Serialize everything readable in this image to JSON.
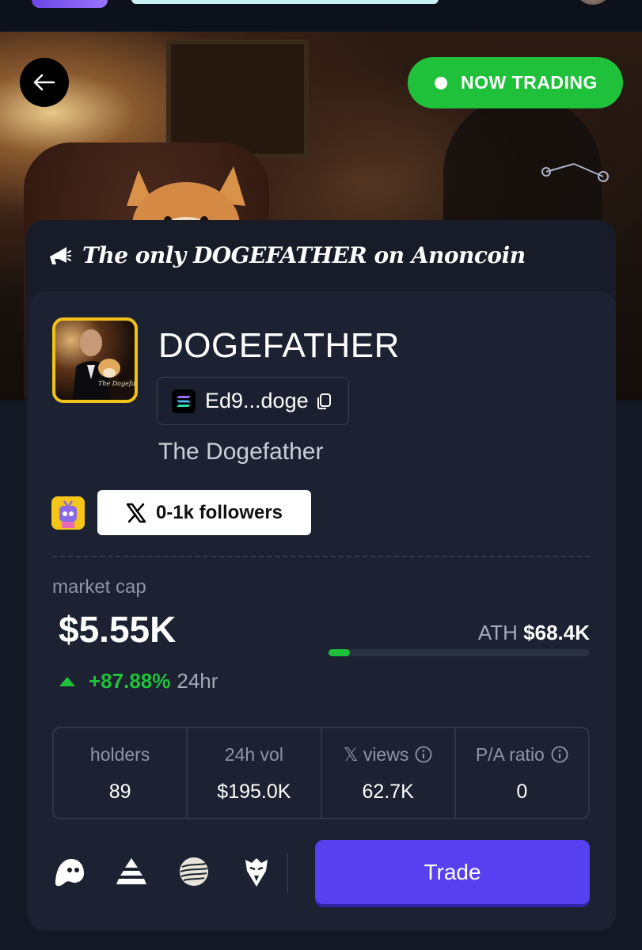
{
  "header": {
    "logo_icon": "anoncoin-logo-icon",
    "avatar_icon": "user-avatar-icon"
  },
  "hero": {
    "back_icon": "arrow-left-icon",
    "status_label": "NOW TRADING",
    "status_color": "#1fc03a"
  },
  "card": {
    "tagline_icon": "megaphone-icon",
    "tagline": "The only DOGEFATHER on Anoncoin"
  },
  "token": {
    "image_caption": "The Dogefather",
    "name": "DOGEFATHER",
    "address_icon": "solana-icon",
    "address": "Ed9...doge",
    "copy_icon": "copy-icon",
    "description": "The Dogefather",
    "creator_icon": "robot-avatar-icon",
    "followers_icon": "x-logo-icon",
    "followers_label": "0-1k followers"
  },
  "market": {
    "label": "market cap",
    "value": "$5.55K",
    "ath_label": "ATH",
    "ath_value": "$68.4K",
    "ath_progress_fraction": 0.081,
    "change": "+87.88%",
    "change_period": "24hr",
    "accent_color": "#1fc03a"
  },
  "stats": [
    {
      "label": "holders",
      "value": "89"
    },
    {
      "label": "24h vol",
      "value": "$195.0K"
    },
    {
      "label": "𝕏 views",
      "value": "62.7K",
      "info_icon": "info-icon"
    },
    {
      "label": "P/A ratio",
      "value": "0",
      "info_icon": "info-icon"
    }
  ],
  "platforms": [
    "ghost-icon",
    "triangle-icon",
    "orb-icon",
    "eagle-icon"
  ],
  "actions": {
    "trade_label": "Trade",
    "trade_color": "#5840f0"
  }
}
